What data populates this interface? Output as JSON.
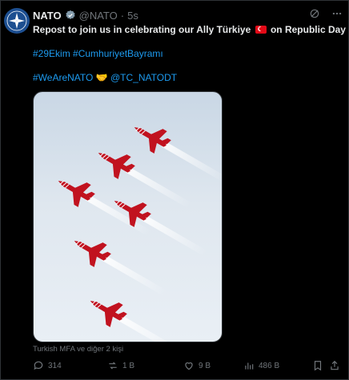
{
  "author": {
    "name": "NATO",
    "handle": "@NATO",
    "separator": "·",
    "time": "5s"
  },
  "tweet": {
    "line1": "Repost to join us in celebrating our Ally Türkiye",
    "line1_suffix": "on Republic Day",
    "hashtags": "#29Ekim #CumhuriyetBayramı",
    "line3_tag": "#WeAreNATO",
    "line3_emoji": "🤝",
    "line3_mention": "@TC_NATODT"
  },
  "media": {
    "caption": "Turkish MFA ve diğer 2 kişi",
    "jets": 6,
    "jet_color": "#c1121f",
    "sky_color": "#dfe7ef"
  },
  "actions": {
    "replies": "314",
    "reposts": "1 B",
    "likes": "9 B",
    "views": "486 B"
  },
  "icons": [
    "nato-logo-icon",
    "verified-icon",
    "grok-icon",
    "more-icon",
    "reply-icon",
    "repost-icon",
    "like-icon",
    "views-icon",
    "bookmark-icon",
    "share-icon"
  ]
}
